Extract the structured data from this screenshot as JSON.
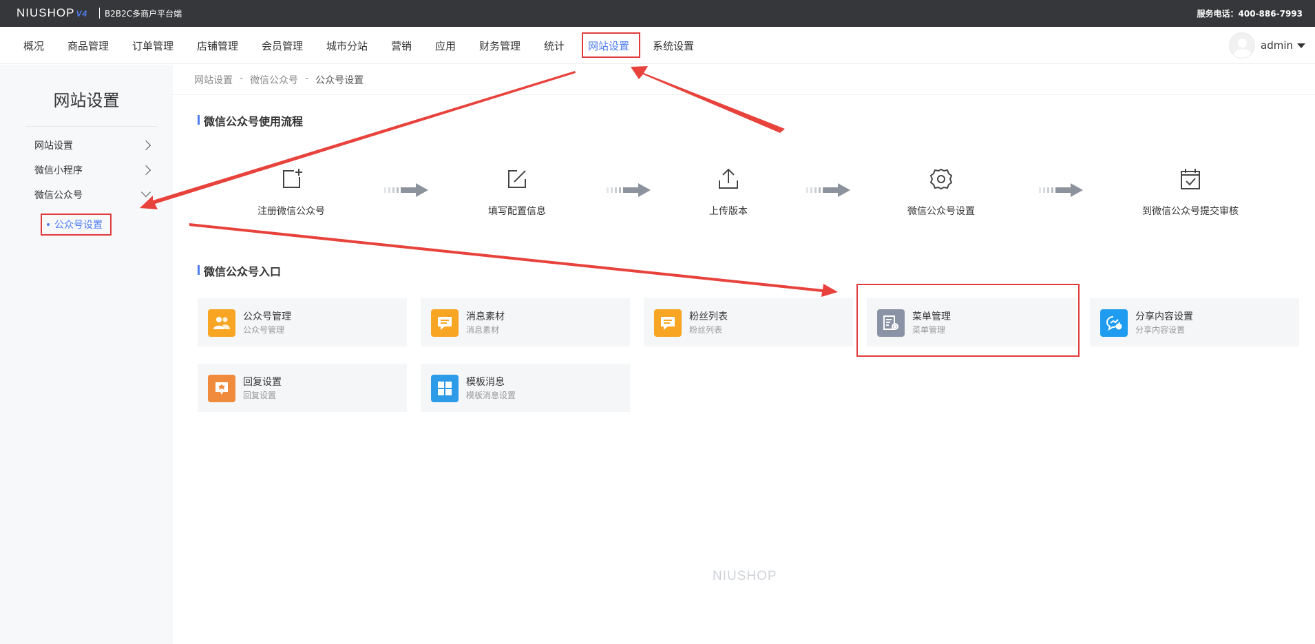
{
  "topbar": {
    "logo": "NIUSHOP",
    "version": "V4",
    "subtitle": "B2B2C多商户平台端",
    "phone": "服务电话：400-886-7993"
  },
  "nav": {
    "items": [
      "概况",
      "商品管理",
      "订单管理",
      "店铺管理",
      "会员管理",
      "城市分站",
      "营销",
      "应用",
      "财务管理",
      "统计",
      "网站设置",
      "系统设置"
    ],
    "active": "网站设置",
    "user": "admin"
  },
  "sidebar": {
    "title": "网站设置",
    "items": [
      {
        "label": "网站设置"
      },
      {
        "label": "微信小程序"
      },
      {
        "label": "微信公众号"
      }
    ],
    "sub_item": "公众号设置"
  },
  "breadcrumb": [
    "网站设置",
    "-",
    "微信公众号",
    "-",
    "公众号设置"
  ],
  "flow": {
    "title": "微信公众号使用流程",
    "steps": [
      {
        "label": "注册微信公众号",
        "icon": "add-square-icon"
      },
      {
        "label": "填写配置信息",
        "icon": "edit-icon"
      },
      {
        "label": "上传版本",
        "icon": "upload-icon"
      },
      {
        "label": "微信公众号设置",
        "icon": "gear-icon"
      },
      {
        "label": "到微信公众号提交审核",
        "icon": "checkbox-icon"
      }
    ]
  },
  "entry": {
    "title": "微信公众号入口",
    "cards": [
      {
        "name": "公众号管理",
        "desc": "公众号管理",
        "color": "#f7a523",
        "icon": "users-icon"
      },
      {
        "name": "消息素材",
        "desc": "消息素材",
        "color": "#f7a523",
        "icon": "message-icon"
      },
      {
        "name": "粉丝列表",
        "desc": "粉丝列表",
        "color": "#f7a523",
        "icon": "message-icon"
      },
      {
        "name": "菜单管理",
        "desc": "菜单管理",
        "color": "#8a93a6",
        "icon": "menu-settings-icon"
      },
      {
        "name": "分享内容设置",
        "desc": "分享内容设置",
        "color": "#1f9cf0",
        "icon": "share-icon"
      },
      {
        "name": "回复设置",
        "desc": "回复设置",
        "color": "#f08a3c",
        "icon": "reply-icon"
      },
      {
        "name": "模板消息",
        "desc": "模板消息设置",
        "color": "#2d9be8",
        "icon": "grid-icon"
      }
    ]
  },
  "footer": {
    "logo": "NIUSHOP"
  },
  "colors": {
    "accent": "#4e7cf1",
    "annotation": "#e23b3b",
    "topbar": "#36373a"
  }
}
